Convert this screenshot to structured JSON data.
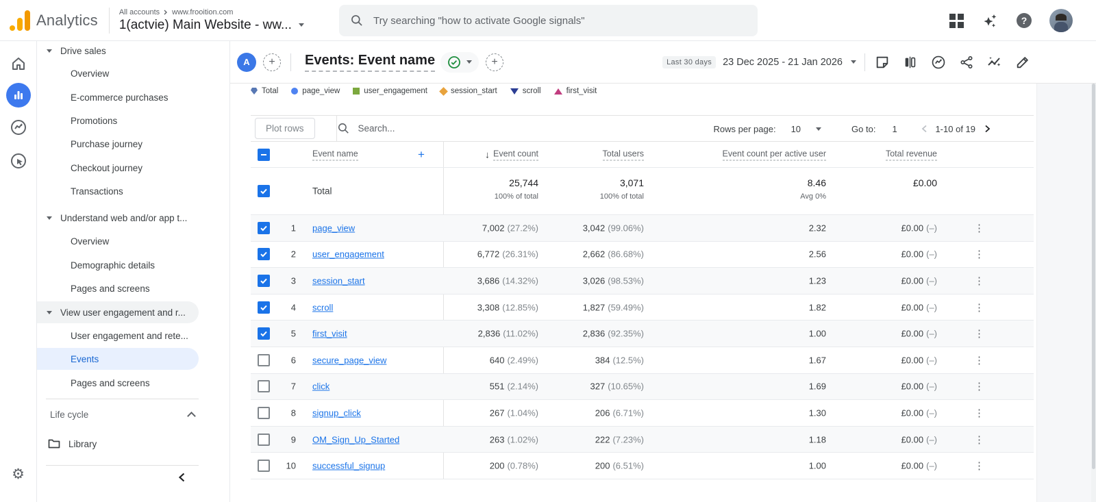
{
  "topbar": {
    "logo_text": "Analytics",
    "breadcrumb_root": "All accounts",
    "breadcrumb_site": "www.frooition.com",
    "property": "1(actvie) Main Website - ww...",
    "search_placeholder": "Try searching \"how to activate Google signals\"",
    "icons": [
      "apps-grid-icon",
      "ai-sparkle-icon",
      "help-icon",
      "user-avatar"
    ]
  },
  "rail": {
    "icons": [
      "home-icon",
      "reports-icon",
      "explore-icon",
      "advertising-icon",
      "settings-gear-icon"
    ]
  },
  "sidebar": {
    "items": [
      {
        "label": "Drive sales"
      },
      {
        "label": "Overview"
      },
      {
        "label": "E-commerce purchases"
      },
      {
        "label": "Promotions"
      },
      {
        "label": "Purchase journey"
      },
      {
        "label": "Checkout journey"
      },
      {
        "label": "Transactions"
      },
      {
        "label": "Understand web and/or app t..."
      },
      {
        "label": "Overview"
      },
      {
        "label": "Demographic details"
      },
      {
        "label": "Pages and screens"
      },
      {
        "label": "View user engagement and r..."
      },
      {
        "label": "User engagement and rete..."
      },
      {
        "label": "Events"
      },
      {
        "label": "Pages and screens"
      }
    ],
    "collection_label": "Life cycle",
    "library_label": "Library"
  },
  "report": {
    "avatar_letter": "A",
    "title": "Events: Event name",
    "date_preset": "Last 30 days",
    "date_range": "23 Dec 2025 - 21 Jan 2026",
    "toolbar_icons": [
      "notes-icon",
      "comparison-icon",
      "explore-link-icon",
      "share-icon",
      "insights-icon",
      "edit-icon"
    ]
  },
  "legend": [
    {
      "label": "Total",
      "color": "#5878b4",
      "shape": "pentagon"
    },
    {
      "label": "page_view",
      "color": "#4f83f1",
      "shape": "circle"
    },
    {
      "label": "user_engagement",
      "color": "#7ca83e",
      "shape": "square"
    },
    {
      "label": "session_start",
      "color": "#e8a33d",
      "shape": "diamond"
    },
    {
      "label": "scroll",
      "color": "#2c3e94",
      "shape": "triangle-down"
    },
    {
      "label": "first_visit",
      "color": "#c13d7f",
      "shape": "triangle-up"
    }
  ],
  "table": {
    "plot_rows_label": "Plot rows",
    "search_placeholder": "Search...",
    "rows_per_page_label": "Rows per page:",
    "rows_per_page_value": "10",
    "goto_label": "Go to:",
    "goto_value": "1",
    "pagination": "1-10 of 19",
    "headers": {
      "name": "Event name",
      "count": "Event count",
      "users": "Total users",
      "per_user": "Event count per active user",
      "revenue": "Total revenue"
    },
    "total": {
      "label": "Total",
      "count": "25,744",
      "count_sub": "100% of total",
      "users": "3,071",
      "users_sub": "100% of total",
      "per_user": "8.46",
      "per_user_sub": "Avg 0%",
      "revenue": "£0.00"
    },
    "rows": [
      {
        "num": "1",
        "name": "page_view",
        "count": "7,002",
        "count_pct": "(27.2%)",
        "users": "3,042",
        "users_pct": "(99.06%)",
        "per_user": "2.32",
        "revenue": "£0.00",
        "revenue_note": "(–)"
      },
      {
        "num": "2",
        "name": "user_engagement",
        "count": "6,772",
        "count_pct": "(26.31%)",
        "users": "2,662",
        "users_pct": "(86.68%)",
        "per_user": "2.56",
        "revenue": "£0.00",
        "revenue_note": "(–)"
      },
      {
        "num": "3",
        "name": "session_start",
        "count": "3,686",
        "count_pct": "(14.32%)",
        "users": "3,026",
        "users_pct": "(98.53%)",
        "per_user": "1.23",
        "revenue": "£0.00",
        "revenue_note": "(–)"
      },
      {
        "num": "4",
        "name": "scroll",
        "count": "3,308",
        "count_pct": "(12.85%)",
        "users": "1,827",
        "users_pct": "(59.49%)",
        "per_user": "1.82",
        "revenue": "£0.00",
        "revenue_note": "(–)"
      },
      {
        "num": "5",
        "name": "first_visit",
        "count": "2,836",
        "count_pct": "(11.02%)",
        "users": "2,836",
        "users_pct": "(92.35%)",
        "per_user": "1.00",
        "revenue": "£0.00",
        "revenue_note": "(–)"
      },
      {
        "num": "6",
        "name": "secure_page_view",
        "count": "640",
        "count_pct": "(2.49%)",
        "users": "384",
        "users_pct": "(12.5%)",
        "per_user": "1.67",
        "revenue": "£0.00",
        "revenue_note": "(–)"
      },
      {
        "num": "7",
        "name": "click",
        "count": "551",
        "count_pct": "(2.14%)",
        "users": "327",
        "users_pct": "(10.65%)",
        "per_user": "1.69",
        "revenue": "£0.00",
        "revenue_note": "(–)"
      },
      {
        "num": "8",
        "name": "signup_click",
        "count": "267",
        "count_pct": "(1.04%)",
        "users": "206",
        "users_pct": "(6.71%)",
        "per_user": "1.30",
        "revenue": "£0.00",
        "revenue_note": "(–)"
      },
      {
        "num": "9",
        "name": "OM_Sign_Up_Started",
        "count": "263",
        "count_pct": "(1.02%)",
        "users": "222",
        "users_pct": "(7.23%)",
        "per_user": "1.18",
        "revenue": "£0.00",
        "revenue_note": "(–)"
      },
      {
        "num": "10",
        "name": "successful_signup",
        "count": "200",
        "count_pct": "(0.78%)",
        "users": "200",
        "users_pct": "(6.51%)",
        "per_user": "1.00",
        "revenue": "£0.00",
        "revenue_note": "(–)"
      }
    ]
  }
}
